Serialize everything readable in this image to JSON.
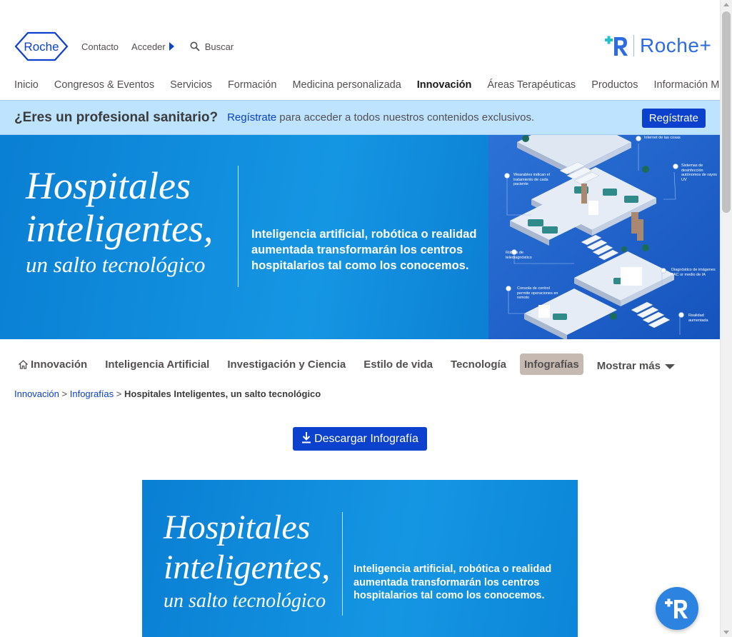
{
  "header": {
    "logo_text": "Roche",
    "contact_label": "Contacto",
    "login_label": "Acceder",
    "search_placeholder": "Buscar",
    "roche_plus_text": "Roche+"
  },
  "main_nav": [
    {
      "label": "Inicio"
    },
    {
      "label": "Congresos & Eventos"
    },
    {
      "label": "Servicios"
    },
    {
      "label": "Formación"
    },
    {
      "label": "Medicina personalizada"
    },
    {
      "label": "Innovación"
    },
    {
      "label": "Áreas Terapéuticas"
    },
    {
      "label": "Productos"
    },
    {
      "label": "Información Médica"
    }
  ],
  "pro_banner": {
    "question": "¿Eres un profesional sanitario?",
    "link_text": "Regístrate",
    "rest_text": "para acceder a todos nuestros contenidos exclusivos.",
    "button_label": "Regístrate"
  },
  "hero": {
    "title_line1": "Hospitales",
    "title_line2": "inteligentes,",
    "title_line3": "un salto tecnológico",
    "subtitle": "Inteligencia artificial, robótica o realidad aumentada transformarán los centros hospitalarios tal como los conocemos.",
    "illustration_labels": {
      "iot": "Internet de las cosas",
      "wearables": "Wearables indican el tratamiento de cada paciente",
      "uv": "Sistemas de desinfección autónomos de rayos UV",
      "robots": "Robots de telediagnóstico",
      "diagnosis": "Diagnóstico de imágenes TAC or medio de IA",
      "console": "Consola de control permite operaciones en remoto",
      "ar": "Realidad aumentada"
    }
  },
  "sub_tabs": [
    {
      "label": "Innovación",
      "icon": "home-icon"
    },
    {
      "label": "Inteligencia Artificial"
    },
    {
      "label": "Investigación y Ciencia"
    },
    {
      "label": "Estilo de vida"
    },
    {
      "label": "Tecnología"
    },
    {
      "label": "Infografías"
    },
    {
      "label": "Mostrar más",
      "icon": "caret-down-icon"
    }
  ],
  "breadcrumb": {
    "items": [
      "Innovación",
      "Infografías"
    ],
    "separator": ">",
    "current": "Hospitales Inteligentes, un salto tecnológico"
  },
  "download_button": {
    "label": "Descargar Infografía",
    "icon": "download-icon"
  },
  "infographic_preview": {
    "title_line1": "Hospitales",
    "title_line2": "inteligentes,",
    "title_line3": "un salto tecnológico",
    "subtitle": "Inteligencia artificial, robótica o realidad aumentada transformarán los centros hospitalarios tal como los conocemos."
  },
  "colors": {
    "brand_blue": "#0b41cd",
    "banner_bg": "#bde3ff",
    "hero_blue": "#1596e3",
    "tab_active_bg": "#c6b9b2",
    "roche_plus_blue": "#2d6cdf"
  }
}
